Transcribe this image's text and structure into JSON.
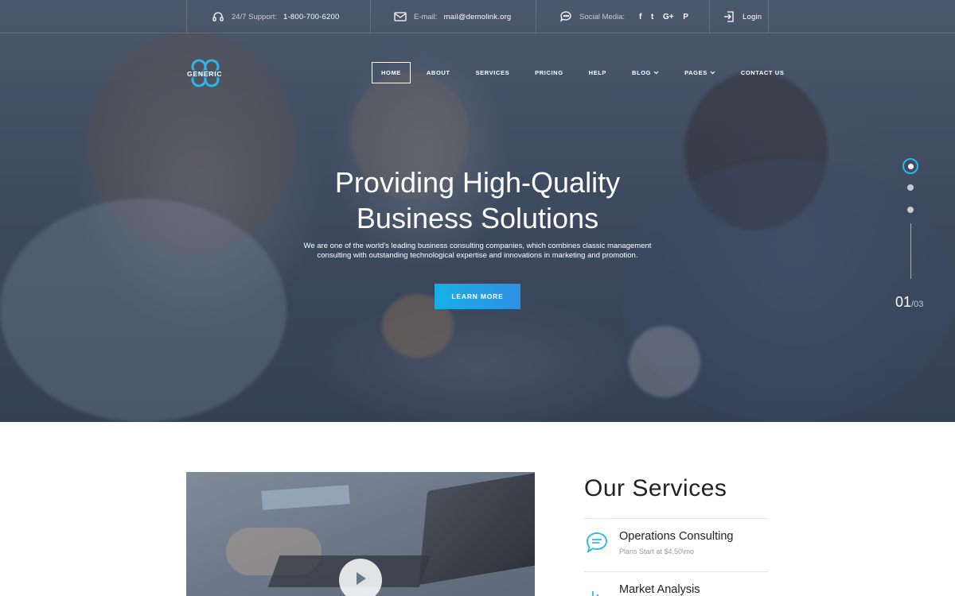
{
  "topbar": {
    "support_label": "24/7 Support:",
    "support_phone": "1-800-700-6200",
    "email_label": "E-mail:",
    "email_value": "mail@demolink.org",
    "social_label": "Social Media:",
    "social_icons": [
      "facebook-icon",
      "twitter-icon",
      "google-plus-icon",
      "pinterest-icon"
    ],
    "social_glyphs": [
      "f",
      "t",
      "G+",
      "P"
    ],
    "login_label": "Login"
  },
  "brand": {
    "logo_text": "GENERIC"
  },
  "nav": {
    "items": [
      {
        "label": "HOME",
        "active": true
      },
      {
        "label": "ABOUT"
      },
      {
        "label": "SERVICES"
      },
      {
        "label": "PRICING"
      },
      {
        "label": "HELP"
      },
      {
        "label": "BLOG",
        "dropdown": true
      },
      {
        "label": "PAGES",
        "dropdown": true
      },
      {
        "label": "CONTACT US"
      }
    ]
  },
  "hero": {
    "title_line1": "Providing High-Quality",
    "title_line2": "Business Solutions",
    "subtitle_line1": "We are one of the world’s leading business consulting companies, which combines classic management",
    "subtitle_line2": "consulting with outstanding technological expertise and innovations in marketing and promotion.",
    "cta_label": "LEARN MORE",
    "slide_current": "01",
    "slide_total": "/03"
  },
  "services": {
    "title": "Our Services",
    "items": [
      {
        "title": "Operations Consulting",
        "price": "Plans Start at $4.50\\mo",
        "icon": "chat-bubble-icon"
      },
      {
        "title": "Market Analysis",
        "icon": "bar-chart-icon"
      }
    ]
  },
  "colors": {
    "accent": "#2bb6ea",
    "cta_start": "#17b0e6",
    "cta_end": "#2f8fe4"
  }
}
